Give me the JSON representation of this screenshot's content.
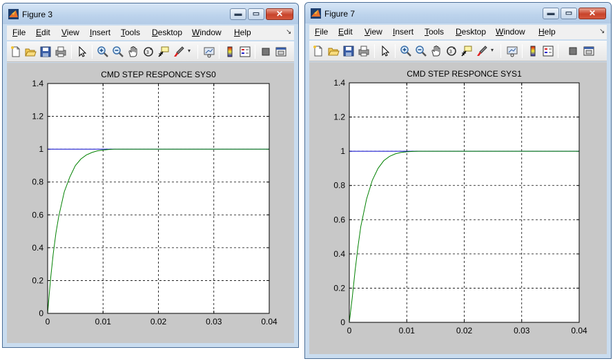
{
  "windows": [
    {
      "title": "Figure 3",
      "menu": [
        "File",
        "Edit",
        "View",
        "Insert",
        "Tools",
        "Desktop",
        "Window",
        "Help"
      ],
      "plot": {
        "title": "CMD STEP RESPONCE SYS0",
        "xlim": [
          0,
          0.04
        ],
        "ylim": [
          0,
          1.4
        ],
        "xticks": [
          "0",
          "0.01",
          "0.02",
          "0.03",
          "0.04"
        ],
        "yticks": [
          "0",
          "0.2",
          "0.4",
          "0.6",
          "0.8",
          "1",
          "1.2",
          "1.4"
        ],
        "grid": true
      }
    },
    {
      "title": "Figure 7",
      "menu": [
        "File",
        "Edit",
        "View",
        "Insert",
        "Tools",
        "Desktop",
        "Window",
        "Help"
      ],
      "plot": {
        "title": "CMD STEP RESPONCE SYS1",
        "xlim": [
          0,
          0.04
        ],
        "ylim": [
          0,
          1.4
        ],
        "xticks": [
          "0",
          "0.01",
          "0.02",
          "0.03",
          "0.04"
        ],
        "yticks": [
          "0",
          "0.2",
          "0.4",
          "0.6",
          "0.8",
          "1",
          "1.2",
          "1.4"
        ],
        "grid": true
      }
    }
  ],
  "toolbar_icons": [
    "new-figure-icon",
    "open-file-icon",
    "save-icon",
    "print-icon",
    "pointer-icon",
    "zoom-in-icon",
    "zoom-out-icon",
    "pan-icon",
    "rotate-3d-icon",
    "data-cursor-icon",
    "brush-icon",
    "link-plot-icon",
    "colorbar-icon",
    "legend-icon",
    "hide-plot-tools-icon",
    "show-plot-tools-icon"
  ],
  "colors": {
    "command_line": "#0000cc",
    "response_line": "#008000",
    "plot_background": "#ffffff",
    "figure_background": "#c8c8c8"
  },
  "chart_data": [
    {
      "type": "line",
      "title": "CMD STEP RESPONCE SYS0",
      "xlabel": "",
      "ylabel": "",
      "xlim": [
        0,
        0.04
      ],
      "ylim": [
        0,
        1.4
      ],
      "grid": true,
      "series": [
        {
          "color": "#0000cc",
          "x": [
            0,
            0.04
          ],
          "y": [
            1,
            1
          ]
        },
        {
          "color": "#008000",
          "x": [
            0,
            0.0005,
            0.001,
            0.0015,
            0.002,
            0.003,
            0.004,
            0.005,
            0.006,
            0.007,
            0.008,
            0.009,
            0.01,
            0.011,
            0.012,
            0.04
          ],
          "y": [
            0,
            0.2,
            0.36,
            0.49,
            0.59,
            0.74,
            0.83,
            0.9,
            0.94,
            0.965,
            0.98,
            0.99,
            0.995,
            0.998,
            1,
            1
          ]
        }
      ]
    },
    {
      "type": "line",
      "title": "CMD STEP RESPONCE SYS1",
      "xlabel": "",
      "ylabel": "",
      "xlim": [
        0,
        0.04
      ],
      "ylim": [
        0,
        1.4
      ],
      "grid": true,
      "series": [
        {
          "color": "#0000cc",
          "x": [
            0,
            0.04
          ],
          "y": [
            1,
            1
          ]
        },
        {
          "color": "#008000",
          "x": [
            0,
            0.0005,
            0.001,
            0.0015,
            0.002,
            0.003,
            0.004,
            0.005,
            0.006,
            0.007,
            0.008,
            0.009,
            0.01,
            0.011,
            0.012,
            0.04
          ],
          "y": [
            0,
            0.14,
            0.3,
            0.44,
            0.56,
            0.72,
            0.83,
            0.9,
            0.945,
            0.97,
            0.985,
            0.993,
            0.997,
            0.999,
            1,
            1
          ]
        }
      ]
    }
  ]
}
